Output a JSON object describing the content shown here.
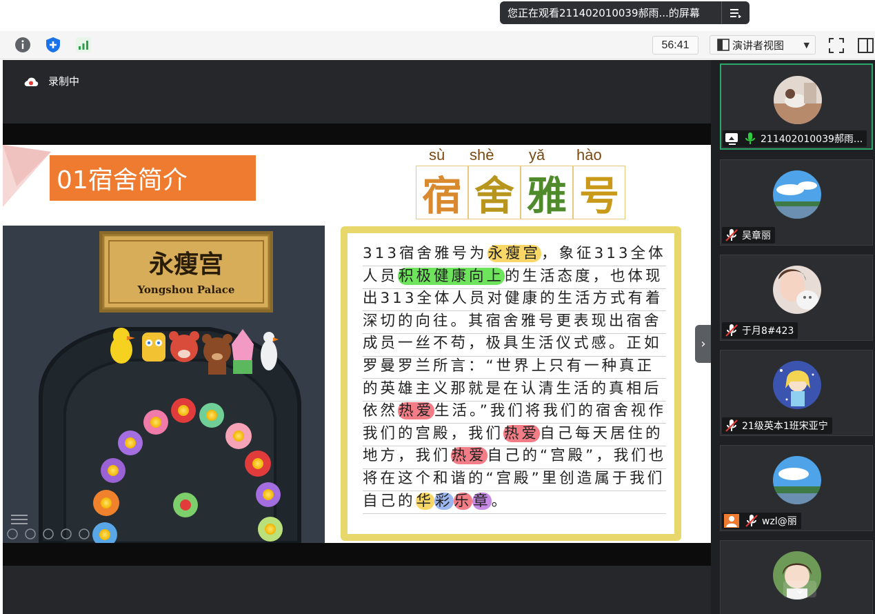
{
  "banner": {
    "text": "您正在观看211402010039郝雨...的屏幕",
    "menu_icon": "list-menu-icon"
  },
  "toolbar": {
    "info_icon": "info-icon",
    "shield_icon": "shield-icon",
    "signal_icon": "signal-bars-icon",
    "timer": "56:41",
    "view_label": "演讲者视图",
    "fullscreen_icon": "fullscreen-icon",
    "sidebar_icon": "sidebar-toggle-icon"
  },
  "main": {
    "recording_label": "录制中"
  },
  "slide": {
    "title": "01宿舍简介",
    "sign_text": "永瘦宫",
    "sign_subtext": "Yongshou Palace",
    "heading_pinyin": [
      "sù",
      "shè",
      "yǎ",
      "hào"
    ],
    "heading_chars": [
      "宿",
      "舍",
      "雅",
      "号"
    ],
    "heading_colors": [
      "#d9892e",
      "#b8961d",
      "#4f8a2d",
      "#c99a1a"
    ],
    "body": {
      "p1": "313宿舍雅号为",
      "hl1": "永瘦宫",
      "p2": "，象征313全体人员",
      "hl2": "积极健康向上",
      "p3": "的生活态度，也体现出313全体人员对健康的生活方式有着深切的向往。其宿舍雅号更表现出宿舍成员一丝不苟，极具生活仪式感。正如罗曼罗兰所言：“世界上只有一种真正的英雄主义那就是在认清生活的真相后依然",
      "hl3": "热爱",
      "p4": "生活。”我们将我们的宿舍视作我们的宫殿，我们",
      "hl4": "热爱",
      "p5": "自己每天居住的地方，我们",
      "hl5": "热爱",
      "p6": "自己的“宫殿”，我们也将在这个和谐的“宫殿”里创造属于我们自己的",
      "hl6": "华",
      "hl7": "彩",
      "hl8": "乐",
      "hl9": "章",
      "p7": "。"
    }
  },
  "participants": [
    {
      "name": "211402010039郝雨...",
      "active": true,
      "icons": [
        "screen-share-icon",
        "mic-on-icon"
      ]
    },
    {
      "name": "吴章丽",
      "active": false,
      "icons": [
        "mic-muted-icon"
      ]
    },
    {
      "name": "于月8#423",
      "active": false,
      "icons": [
        "mic-muted-icon"
      ]
    },
    {
      "name": "21级英本1班宋亚宁",
      "active": false,
      "icons": [
        "mic-muted-icon"
      ]
    },
    {
      "name": "wzl@丽",
      "active": false,
      "icons": [
        "user-placeholder-icon",
        "mic-muted-icon"
      ]
    },
    {
      "name": "",
      "active": false,
      "icons": []
    }
  ],
  "colors": {
    "accent_orange": "#ee7b30",
    "note_border": "#e8d86b",
    "active_tile_border": "#2aa86a",
    "main_bg": "#25272b"
  }
}
